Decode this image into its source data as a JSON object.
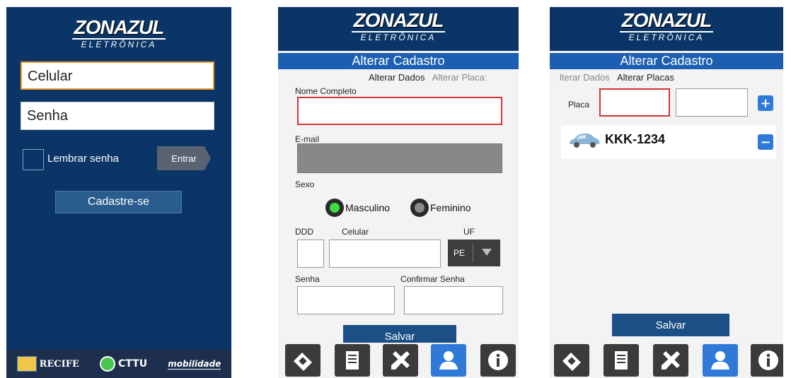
{
  "brand": {
    "logo_top": "ZONAZUL",
    "logo_bottom": "ELETRÔNICA"
  },
  "login": {
    "celular_placeholder": "Celular",
    "senha_placeholder": "Senha",
    "remember_label": "Lembrar senha",
    "entrar_label": "Entrar",
    "cadastre_label": "Cadastre-se",
    "footer": {
      "recife": "RECIFE",
      "cttu": "CTTU",
      "mobilidade": "mobilidade"
    }
  },
  "alterar": {
    "title": "Alterar Cadastro",
    "tab_dados": "Alterar Dados",
    "tab_placas": "Alterar Placa:",
    "nome_label": "Nome Completo",
    "email_label": "E-mail",
    "sexo_label": "Sexo",
    "masculino": "Masculino",
    "feminino": "Feminino",
    "ddd_label": "DDD",
    "celular_label": "Celular",
    "uf_label": "UF",
    "uf_value": "PE",
    "senha_label": "Senha",
    "confirmar_label": "Confirmar Senha",
    "salvar_label": "Salvar"
  },
  "placas": {
    "title": "Alterar Cadastro",
    "tab_dados": "lterar Dados",
    "tab_placas": "Alterar Placas",
    "placa_label": "Placa",
    "add_symbol": "+",
    "remove_symbol": "−",
    "plates": [
      "KKK-1234"
    ],
    "salvar_label": "Salvar"
  },
  "colors": {
    "navy": "#0b3566",
    "accent_blue": "#1c5fb2",
    "active_icon": "#2f7ad9",
    "error_red": "#d43535",
    "orange_focus": "#f29a2a",
    "radio_green": "#3fdc3f"
  },
  "icons": [
    "ticket-icon",
    "receipt-icon",
    "tools-icon",
    "user-icon",
    "info-icon"
  ]
}
